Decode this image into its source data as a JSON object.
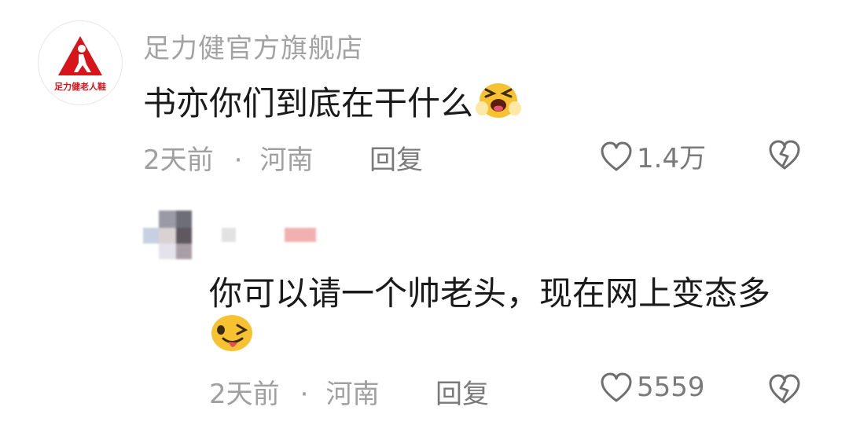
{
  "comment": {
    "username": "足力健官方旗舰店",
    "avatar_icon": "walking-person-logo-icon",
    "avatar_label": "足力健老人鞋",
    "text": "书亦你们到底在干什么",
    "emoji": "crying-face-emoji",
    "time": "2天前",
    "separator": "·",
    "location": "河南",
    "reply_label": "回复",
    "likes": "1.4万",
    "like_icon": "heart-outline-icon",
    "dislike_icon": "broken-heart-icon"
  },
  "reply": {
    "text": "你可以请一个帅老头，现在网上变态多",
    "emoji": "winking-tongue-face-emoji",
    "time": "2天前",
    "separator": "·",
    "location": "河南",
    "reply_label": "回复",
    "likes": "5559",
    "like_icon": "heart-outline-icon",
    "dislike_icon": "broken-heart-icon"
  },
  "colors": {
    "brand_red": "#d7141a",
    "meta_gray": "#a0a0a0",
    "emoji_yellow": "#f7c231"
  }
}
